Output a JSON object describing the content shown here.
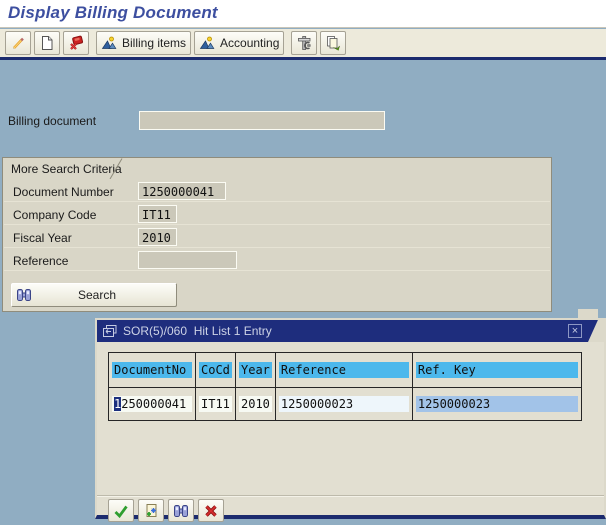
{
  "header": {
    "title": "Display Billing Document"
  },
  "toolbar": {
    "billing_items_label": "Billing items",
    "accounting_label": "Accounting"
  },
  "form": {
    "billing_document_label": "Billing document",
    "billing_document_value": ""
  },
  "search_panel": {
    "tab_title": "More Search Criteria",
    "fields": [
      {
        "label": "Document Number",
        "value": "1250000041"
      },
      {
        "label": "Company Code",
        "value": "IT11"
      },
      {
        "label": "Fiscal Year",
        "value": "2010"
      },
      {
        "label": "Reference",
        "value": ""
      }
    ],
    "search_button": "Search"
  },
  "dialog": {
    "title": "SOR(5)/060  Hit List 1 Entry",
    "close_glyph": "×",
    "columns": [
      "DocumentNo",
      "CoCd",
      "Year",
      "Reference",
      "Ref. Key"
    ],
    "row": {
      "document_no_cursor": "1",
      "document_no_rest": "250000041",
      "cocd": "IT11",
      "year": "2010",
      "reference": "1250000023",
      "ref_key": "1250000023"
    }
  },
  "icons": {
    "toolbar": [
      "pencil-icon",
      "new-document-icon",
      "cancel-document-icon",
      "overview-icon",
      "overview-icon",
      "tools-icon",
      "output-icon"
    ],
    "search": "binoculars-icon",
    "dialog_title": "window-icon",
    "dialog_footer": [
      "check-icon",
      "new-search-icon",
      "binoculars-icon",
      "red-x-icon"
    ]
  },
  "colors": {
    "main_bg": "#90adc2",
    "title_text": "#3d4fa0",
    "toolbar_bg": "#edeadb",
    "panel_bg": "#d9d6c7",
    "input_bg": "#cbc8b9",
    "dialog_bg": "#e2dfd1",
    "dialog_titlebar": "#1e2d7d",
    "header_highlight": "#4cb8ec",
    "ref_key_cell": "#a2c3e8",
    "navy_separator": "#1c2b6e"
  }
}
